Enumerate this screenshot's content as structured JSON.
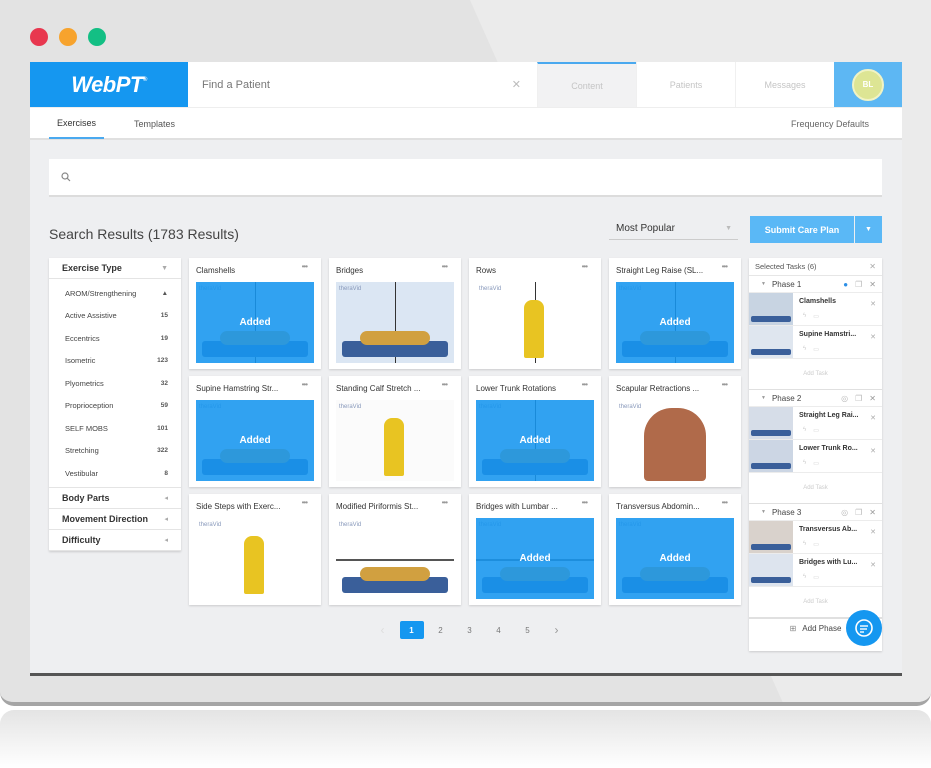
{
  "window": {
    "dot_colors": [
      "#e8374f",
      "#f7a32d",
      "#13bf84"
    ]
  },
  "topbar": {
    "logo": "WebPT",
    "logo_mark": "®",
    "search_placeholder": "Find a Patient",
    "clear_icon": "✕",
    "nav": [
      {
        "label": "Content",
        "active": true
      },
      {
        "label": "Patients",
        "active": false
      },
      {
        "label": "Messages",
        "active": false
      }
    ],
    "avatar_initials": "BL"
  },
  "subnav": {
    "tabs": [
      {
        "label": "Exercises",
        "active": true
      },
      {
        "label": "Templates",
        "active": false
      }
    ],
    "right_link": "Frequency Defaults"
  },
  "search": {
    "placeholder": "",
    "icon": "search-icon"
  },
  "results": {
    "title": "Search Results (1783 Results)",
    "sort_value": "Most Popular",
    "submit_label": "Submit Care Plan"
  },
  "filters": {
    "exercise_type": {
      "label": "Exercise Type",
      "items": [
        {
          "label": "AROM/Strengthening",
          "count": "▲"
        },
        {
          "label": "Active Assistive",
          "count": "15"
        },
        {
          "label": "Eccentrics",
          "count": "19"
        },
        {
          "label": "Isometric",
          "count": "123"
        },
        {
          "label": "Plyometrics",
          "count": "32"
        },
        {
          "label": "Proprioception",
          "count": "59"
        },
        {
          "label": "SELF MOBS",
          "count": "101"
        },
        {
          "label": "Stretching",
          "count": "322"
        },
        {
          "label": "Vestibular",
          "count": "8"
        }
      ]
    },
    "collapsed": [
      "Body Parts",
      "Movement Direction",
      "Difficulty"
    ]
  },
  "cards": [
    {
      "title": "Clamshells",
      "added": true,
      "added_label": "Added"
    },
    {
      "title": "Bridges",
      "added": false
    },
    {
      "title": "Rows",
      "added": false
    },
    {
      "title": "Straight Leg Raise (SL...",
      "added": true,
      "added_label": "Added"
    },
    {
      "title": "Supine Hamstring Str...",
      "added": true,
      "added_label": "Added"
    },
    {
      "title": "Standing Calf Stretch ...",
      "added": false
    },
    {
      "title": "Lower Trunk Rotations",
      "added": true,
      "added_label": "Added"
    },
    {
      "title": "Scapular Retractions ...",
      "added": false
    },
    {
      "title": "Side Steps with Exerc...",
      "added": false
    },
    {
      "title": "Modified Piriformis St...",
      "added": false
    },
    {
      "title": "Bridges with Lumbar ...",
      "added": true,
      "added_label": "Added"
    },
    {
      "title": "Transversus Abdomin...",
      "added": true,
      "added_label": "Added"
    }
  ],
  "card_brand": "theraVid",
  "card_more": "•••",
  "pagination": {
    "pages": [
      "1",
      "2",
      "3",
      "4",
      "5"
    ],
    "current": "1",
    "prev": "‹",
    "next": "›"
  },
  "selected_tasks": {
    "title": "Selected Tasks (6)",
    "phases": [
      {
        "label": "Phase 1",
        "tasks": [
          "Clamshells",
          "Supine Hamstri..."
        ],
        "add_task": "Add Task"
      },
      {
        "label": "Phase 2",
        "tasks": [
          "Straight Leg Rai...",
          "Lower Trunk Ro..."
        ],
        "add_task": "Add Task"
      },
      {
        "label": "Phase 3",
        "tasks": [
          "Transversus Ab...",
          "Bridges with Lu..."
        ],
        "add_task": "Add Task"
      }
    ],
    "add_phase": "Add Phase"
  },
  "colors": {
    "accent": "#1597f0",
    "added_overlay": "#1696f0",
    "submit": "#5ab8f6"
  }
}
